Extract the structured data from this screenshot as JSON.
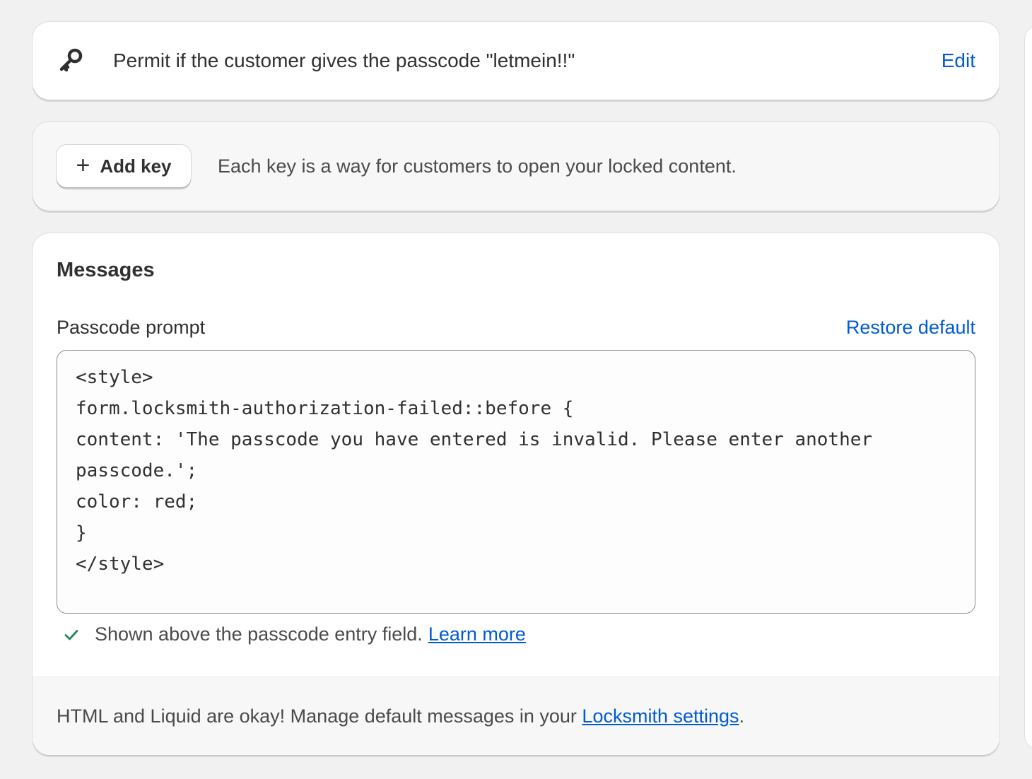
{
  "key_card": {
    "icon": "key-icon",
    "text": "Permit if the customer gives the passcode \"letmein!!\"",
    "edit_label": "Edit"
  },
  "add_key_card": {
    "button_label": "Add key",
    "button_icon": "plus-icon",
    "description": "Each key is a way for customers to open your locked content."
  },
  "messages": {
    "title": "Messages",
    "passcode_prompt_label": "Passcode prompt",
    "restore_default_label": "Restore default",
    "passcode_prompt_value": "<style>\nform.locksmith-authorization-failed::before {\ncontent: 'The passcode you have entered is invalid. Please enter another passcode.';\ncolor: red;\n}\n</style>",
    "help_text": "Shown above the passcode entry field.",
    "learn_more_label": "Learn more",
    "footer_text_before": "HTML and Liquid are okay! Manage default messages in your ",
    "footer_link_label": "Locksmith settings",
    "footer_text_after": "."
  },
  "colors": {
    "link": "#005bd3",
    "check": "#29845a",
    "background": "#f1f1f1"
  }
}
